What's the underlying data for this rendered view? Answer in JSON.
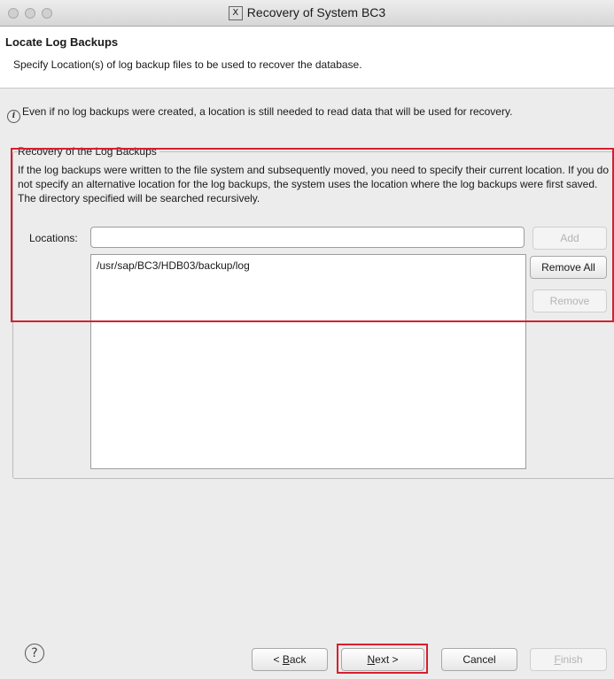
{
  "window": {
    "title": "Recovery of System BC3",
    "app_icon": "x11-icon"
  },
  "header": {
    "title": "Locate Log Backups",
    "description": "Specify Location(s) of log backup files to be used to recover the database."
  },
  "info": {
    "icon": "info-icon",
    "text": "Even if no log backups were created, a location is still needed to read data that will be used for recovery."
  },
  "group": {
    "title": "Recovery of the Log Backups",
    "description": "If the log backups were written to the file system and subsequently moved, you need to specify their current location. If you do not specify an alternative location for the log backups, the system uses the location where the log backups were first saved. The directory specified will be searched recursively."
  },
  "locations": {
    "label": "Locations:",
    "input_value": "",
    "items": [
      "/usr/sap/BC3/HDB03/backup/log"
    ],
    "add_label": "Add",
    "remove_all_label": "Remove All",
    "remove_label": "Remove"
  },
  "footer": {
    "help_icon": "help-icon",
    "help_glyph": "?",
    "back_label_prefix": "< ",
    "back_label_accel": "B",
    "back_label_rest": "ack",
    "next_label_accel": "N",
    "next_label_rest": "ext >",
    "cancel_label": "Cancel",
    "finish_label_accel": "F",
    "finish_label_rest": "inish"
  },
  "colors": {
    "highlight": "#d61f2f"
  }
}
